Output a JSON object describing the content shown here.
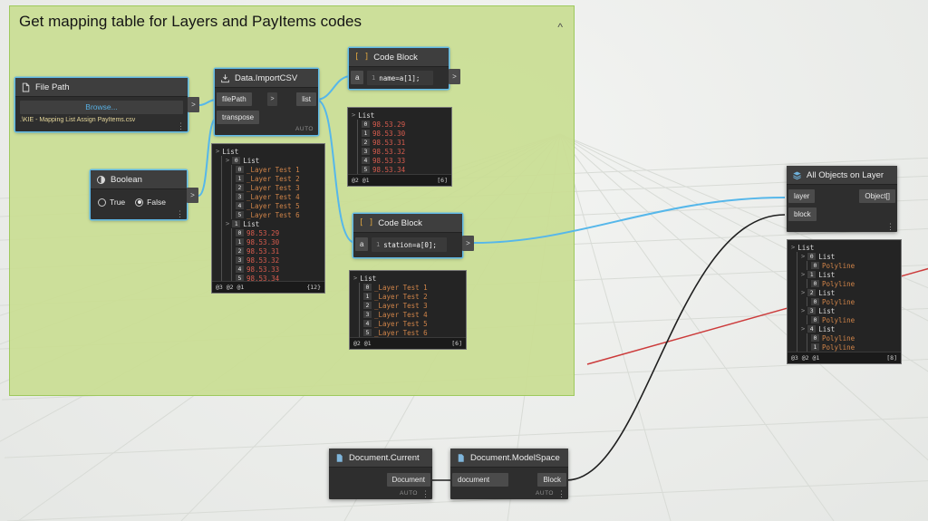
{
  "ui": {
    "dots": "⋮",
    "caret": ">",
    "collapse": "^"
  },
  "badges": [
    "0",
    "1",
    "2",
    "3",
    "4",
    "5"
  ],
  "group": {
    "title": "Get mapping table for Layers and PayItems codes"
  },
  "nodes": {
    "file_path": {
      "title": "File Path",
      "browse": "Browse...",
      "path": ".\\KIE - Mapping List Assign PayItems.csv",
      "out": ">"
    },
    "import_csv": {
      "title": "Data.ImportCSV",
      "in1": "filePath",
      "in2": "transpose",
      "out": "list",
      "lacing": "AUTO",
      "default_arrow": ">"
    },
    "boolean": {
      "title": "Boolean",
      "true_label": "True",
      "false_label": "False",
      "out": ">"
    },
    "code_name": {
      "title": "Code Block",
      "icon": "[ ]",
      "input": "a",
      "line": "1",
      "code": "name=a[1];",
      "out": ">"
    },
    "code_station": {
      "title": "Code Block",
      "icon": "[ ]",
      "input": "a",
      "line": "1",
      "code": "station=a[0];",
      "out": ">"
    },
    "all_objects": {
      "title": "All Objects on Layer",
      "in1": "layer",
      "in2": "block",
      "out": "Object[]"
    },
    "doc_current": {
      "title": "Document.Current",
      "out": "Document",
      "lacing": "AUTO"
    },
    "doc_modelspace": {
      "title": "Document.ModelSpace",
      "input": "document",
      "out": "Block",
      "lacing": "AUTO"
    }
  },
  "previews": {
    "csv": {
      "root": "List",
      "g0_badge": "0",
      "g0_type": "List",
      "g0_items": [
        "_Layer Test 1",
        "_Layer Test 2",
        "_Layer Test 3",
        "_Layer Test 4",
        "_Layer Test 5",
        "_Layer Test 6"
      ],
      "g1_badge": "1",
      "g1_type": "List",
      "g1_items": [
        "98.53.29",
        "98.53.30",
        "98.53.31",
        "98.53.32",
        "98.53.33",
        "98.53.34"
      ],
      "footer_left": "@3 @2 @1",
      "footer_right": "{12}"
    },
    "code_name": {
      "root": "List",
      "items": [
        "98.53.29",
        "98.53.30",
        "98.53.31",
        "98.53.32",
        "98.53.33",
        "98.53.34"
      ],
      "footer_left": "@2 @1",
      "footer_right": "[6]"
    },
    "code_station": {
      "root": "List",
      "items": [
        "_Layer Test 1",
        "_Layer Test 2",
        "_Layer Test 3",
        "_Layer Test 4",
        "_Layer Test 5",
        "_Layer Test 6"
      ],
      "footer_left": "@2 @1",
      "footer_right": "[6]"
    },
    "all_objects": {
      "root": "List",
      "groups": [
        {
          "badge": "0",
          "type": "List",
          "items": [
            {
              "badge": "0",
              "text": "Polyline"
            }
          ]
        },
        {
          "badge": "1",
          "type": "List",
          "items": [
            {
              "badge": "0",
              "text": "Polyline"
            }
          ]
        },
        {
          "badge": "2",
          "type": "List",
          "items": [
            {
              "badge": "0",
              "text": "Polyline"
            }
          ]
        },
        {
          "badge": "3",
          "type": "List",
          "items": [
            {
              "badge": "0",
              "text": "Polyline"
            }
          ]
        },
        {
          "badge": "4",
          "type": "List",
          "items": [
            {
              "badge": "0",
              "text": "Polyline"
            },
            {
              "badge": "1",
              "text": "Polyline"
            }
          ]
        }
      ],
      "footer_left": "@3 @2 @1",
      "footer_right": "[8]"
    }
  }
}
